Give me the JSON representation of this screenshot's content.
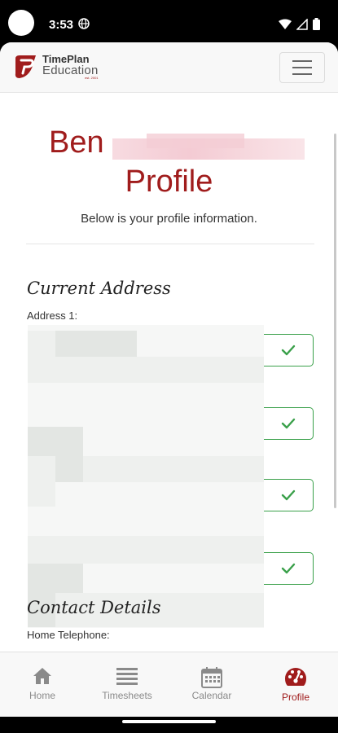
{
  "status_bar": {
    "time": "3:53"
  },
  "brand": {
    "line1": "TimePlan",
    "line2": "Education",
    "line3": "est. 2001",
    "accent_color": "#a01c1c"
  },
  "header": {
    "menu_icon": "hamburger-icon"
  },
  "profile": {
    "name_first": "Ben",
    "title": "Profile",
    "subtitle": "Below is your profile information."
  },
  "sections": {
    "current_address": {
      "title": "Current Address",
      "address1_label": "Address 1:",
      "verified_icon": "check-icon",
      "check_color": "#3aa04a"
    },
    "contact_details": {
      "title": "Contact Details",
      "home_telephone_label": "Home Telephone:"
    }
  },
  "bottom_nav": {
    "tabs": [
      {
        "label": "Home",
        "icon": "home-icon",
        "active": false
      },
      {
        "label": "Timesheets",
        "icon": "list-icon",
        "active": false
      },
      {
        "label": "Calendar",
        "icon": "calendar-icon",
        "active": false
      },
      {
        "label": "Profile",
        "icon": "gauge-icon",
        "active": true
      }
    ]
  }
}
